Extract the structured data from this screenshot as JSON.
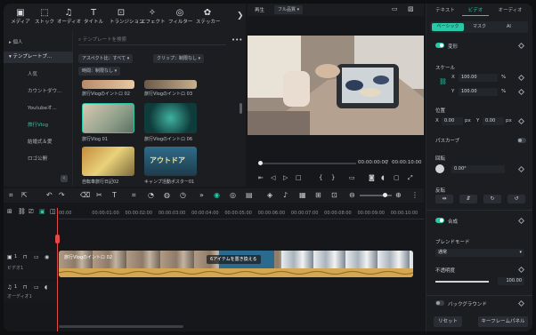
{
  "toolbar": {
    "items": [
      {
        "icon": "media-icon",
        "label": "メディア"
      },
      {
        "icon": "stock-icon",
        "label": "ストック"
      },
      {
        "icon": "audio-icon",
        "label": "オーディオ"
      },
      {
        "icon": "title-icon",
        "label": "タイトル"
      },
      {
        "icon": "transition-icon",
        "label": "トランジション"
      },
      {
        "icon": "effect-icon",
        "label": "エフェクト"
      },
      {
        "icon": "filter-icon",
        "label": "フィルター"
      },
      {
        "icon": "sticker-icon",
        "label": "ステッカー"
      }
    ]
  },
  "leftnav": {
    "items": [
      "個人",
      "テンプレートプ...",
      "人気",
      "カウントダウ...",
      "Youtubeオ...",
      "旅行Vlog",
      "結婚式＆愛",
      "ロゴ公開"
    ]
  },
  "templates": {
    "search_placeholder": "テンプレートを検索",
    "filter_aspect": "アスペクト比：すべて",
    "filter_clip": "クリップ：制限なし",
    "filter_time": "時間：制限なし",
    "items": [
      {
        "caption": "旅行Vlogのイントロ 02"
      },
      {
        "caption": "旅行Vlogのイントロ 03"
      },
      {
        "caption": "旅行Vlog 01"
      },
      {
        "caption": "旅行Vlogのイントロ 06"
      },
      {
        "caption": "自転車旅行日記02"
      },
      {
        "caption": "キャンプ活動ポスター01"
      }
    ],
    "thumb_text": "アウトドア"
  },
  "preview": {
    "tab_play": "再生",
    "quality": "フル品質",
    "time_current": "00:00:00:00",
    "time_sep": "/",
    "time_total": "00:00:10:00",
    "progress": 0.02
  },
  "inspector": {
    "tabs": [
      "テキスト",
      "ビデオ",
      "オーディオ"
    ],
    "subtabs": [
      "ベーシック",
      "マスク",
      "AI"
    ],
    "transform_label": "変形",
    "scale_label": "スケール",
    "scale_x_label": "X",
    "scale_x": "100.00",
    "scale_y_label": "Y",
    "scale_y": "100.00",
    "percent": "%",
    "position_label": "位置",
    "pos_x_label": "X",
    "pos_x": "0.00",
    "pos_y_label": "Y",
    "pos_y": "0.00",
    "px": "px",
    "pathcurve_label": "パスカーブ",
    "rotate_label": "回転",
    "rotate_value": "0.00°",
    "flip_label": "反転",
    "composite_label": "合成",
    "blend_label": "ブレンドモード",
    "blend_value": "通常",
    "opacity_label": "不透明度",
    "opacity_value": "100.00",
    "opacity": 1.0,
    "background_label": "バックグラウンド",
    "reset_button": "リセット",
    "keyframe_button": "キーフレームパネル"
  },
  "timeline": {
    "ticks": [
      "00:00",
      "00:00:01:00",
      "00:00:02:00",
      "00:00:03:00",
      "00:00:04:00",
      "00:00:05:00",
      "00:00:06:00",
      "00:00:07:00",
      "00:00:08:00",
      "00:00:09:00",
      "00:00:10:00"
    ],
    "video_track": "ビデオ1",
    "audio_track": "オーディオ1",
    "clip_title": "旅行Vlogのイントロ 02",
    "replace_label": "6アイテムを置き換える",
    "track_num_video": "1",
    "track_num_audio": "1"
  },
  "colors": {
    "accent": "#29c9a8",
    "panel": "#1b1d21",
    "clip": "#e0b15a"
  }
}
